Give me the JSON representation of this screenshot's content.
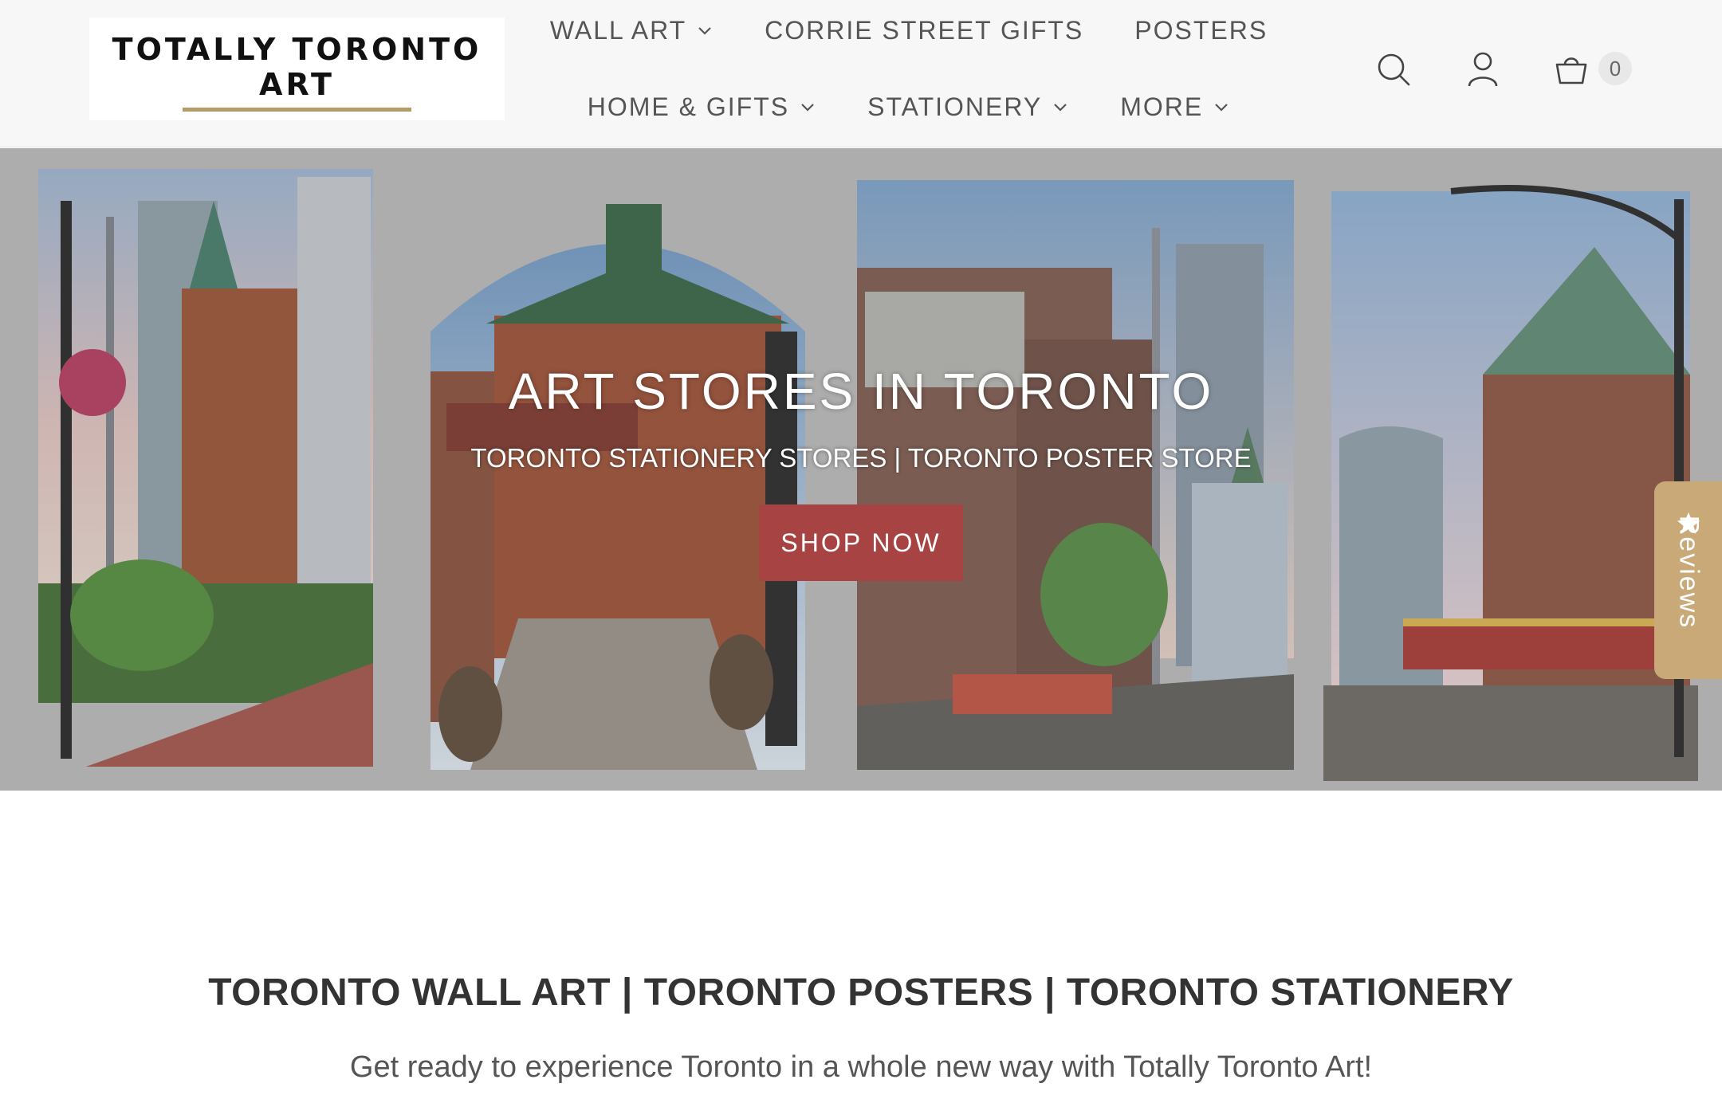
{
  "logo": {
    "line1": "TOTALLY TORONTO",
    "line2": "ART",
    "accent_color": "#b39b6a"
  },
  "nav": {
    "row1": [
      {
        "label": "WALL ART",
        "has_dropdown": true
      },
      {
        "label": "CORRIE STREET GIFTS",
        "has_dropdown": false
      },
      {
        "label": "POSTERS",
        "has_dropdown": false
      }
    ],
    "row2": [
      {
        "label": "HOME & GIFTS",
        "has_dropdown": true
      },
      {
        "label": "STATIONERY",
        "has_dropdown": true
      },
      {
        "label": "MORE",
        "has_dropdown": true
      }
    ]
  },
  "header_icons": {
    "search": "search-icon",
    "account": "user-icon",
    "cart": "basket-icon",
    "cart_count": "0"
  },
  "hero": {
    "title": "ART STORES IN TORONTO",
    "subtitle": "TORONTO STATIONERY STORES | TORONTO POSTER STORE",
    "button_label": "SHOP NOW",
    "button_color": "#a74443"
  },
  "reviews_tab": {
    "label": "Reviews",
    "color": "#c9a977",
    "icon": "star-icon"
  },
  "intro": {
    "title": "TORONTO WALL ART | TORONTO POSTERS | TORONTO STATIONERY",
    "text": "Get ready to experience Toronto in a whole new way with Totally Toronto Art!"
  }
}
